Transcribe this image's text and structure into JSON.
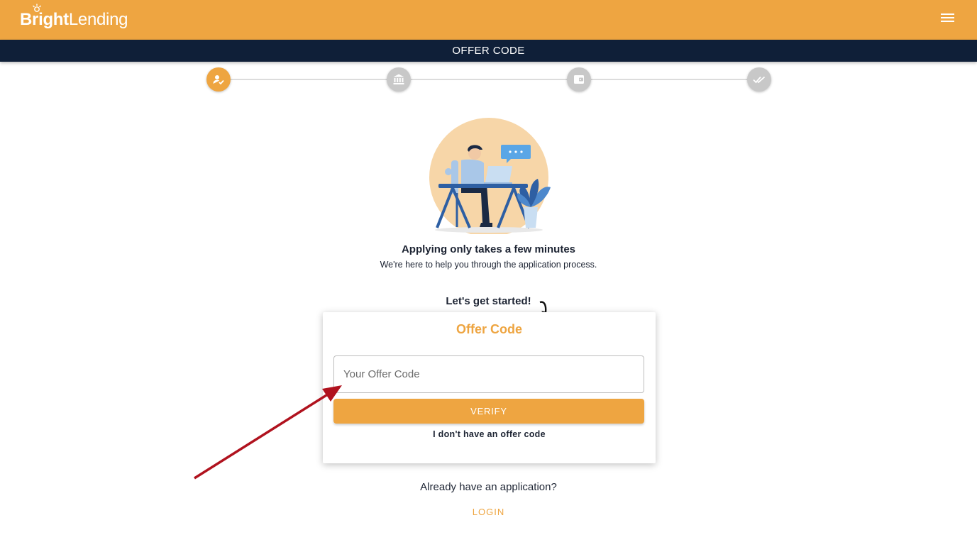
{
  "header": {
    "logo_bold": "Bright",
    "logo_light": "Lending",
    "menu_icon": "hamburger-menu-icon",
    "brand_color": "#eea541"
  },
  "subheader": {
    "title": "OFFER CODE",
    "background": "#0f1f38"
  },
  "stepper": {
    "steps": [
      {
        "icon": "person-check-icon",
        "state": "active"
      },
      {
        "icon": "bank-icon",
        "state": "inactive"
      },
      {
        "icon": "wallet-icon",
        "state": "inactive"
      },
      {
        "icon": "double-check-icon",
        "state": "inactive"
      }
    ]
  },
  "intro": {
    "headline": "Applying only takes a few minutes",
    "subline": "We're here to help you through the application process.",
    "start_text": "Let's get started!"
  },
  "offer_card": {
    "title": "Offer Code",
    "input_placeholder": "Your Offer Code",
    "input_value": "",
    "verify_label": "VERIFY",
    "no_code_label": "I don't have an offer code"
  },
  "footer": {
    "already_text": "Already have an application?",
    "login_label": "LOGIN"
  }
}
